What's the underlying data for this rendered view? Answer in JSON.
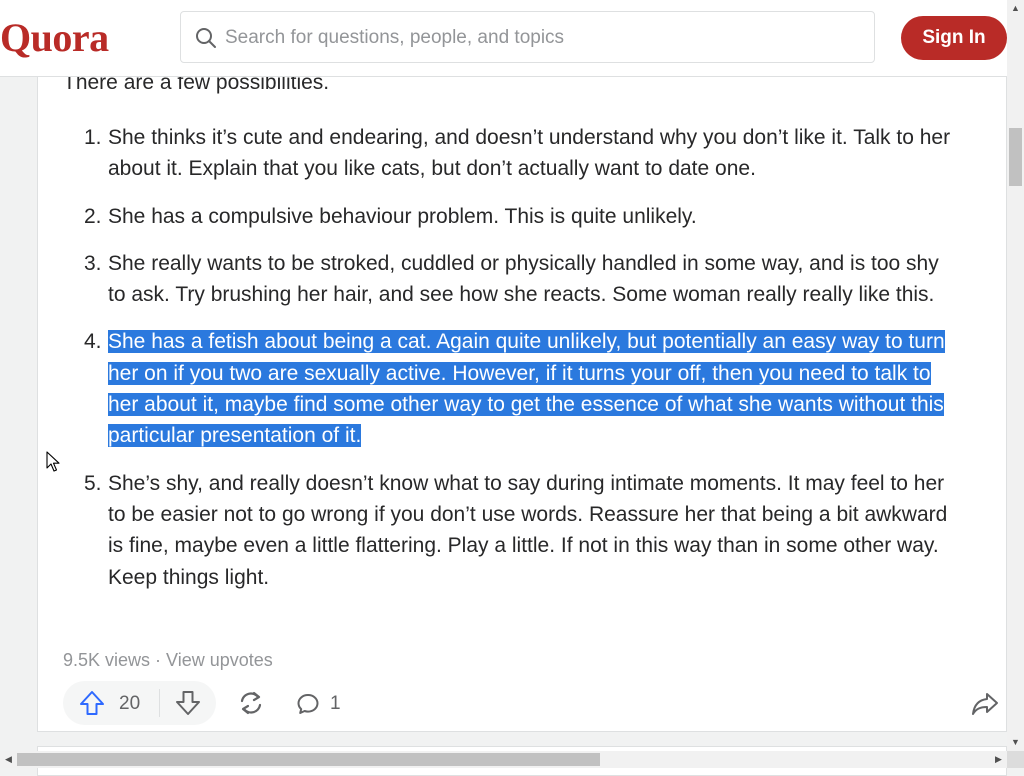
{
  "header": {
    "logo": "Quora",
    "search_placeholder": "Search for questions, people, and topics",
    "signin_label": "Sign In"
  },
  "answer": {
    "intro": "There are a few possibilities.",
    "items": [
      {
        "num": "1.",
        "text": "She thinks it’s cute and endearing, and doesn’t understand why you don’t like it. Talk to her about it. Explain that you like cats, but don’t actually want to date one."
      },
      {
        "num": "2.",
        "text": "She has a compulsive behaviour problem. This is quite unlikely."
      },
      {
        "num": "3.",
        "text": "She really wants to be stroked, cuddled or physically handled in some way, and is too shy to ask. Try brushing her hair, and see how she reacts. Some woman really really like this."
      },
      {
        "num": "4.",
        "text": "She has a fetish about being a cat. Again quite unlikely, but potentially an easy way to turn her on if you two are sexually active. However, if it turns your off, then you need to talk to her about it, maybe find some other way to get the essence of what she wants without this particular presentation of it."
      },
      {
        "num": "5.",
        "text": "She’s shy, and really doesn’t know what to say during intimate moments. It may feel to her to be easier not to go wrong if you don’t use words. Reassure her that being a bit awkward is fine, maybe even a little flattering. Play a little. If not in this way than in some other way. Keep things light."
      }
    ],
    "highlighted_item": 4,
    "views": "9.5K views",
    "separator": "·",
    "view_upvotes": "View upvotes",
    "upvote_count": "20",
    "comment_count": "1"
  },
  "icons": {
    "search": "search-icon",
    "upvote": "upvote-arrow-icon",
    "downvote": "downvote-arrow-icon",
    "share": "reshare-icon",
    "comment": "comment-icon",
    "forward": "share-forward-icon",
    "cursor": "mouse-pointer-icon"
  },
  "colors": {
    "brand": "#b92b27",
    "selection": "#2b79de",
    "upvote": "#2e69ff",
    "muted": "#939598",
    "text": "#282829"
  }
}
